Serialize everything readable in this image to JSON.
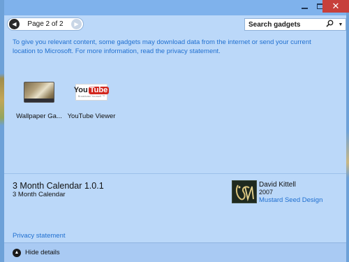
{
  "window": {
    "minimize_icon": "minimize-icon",
    "maximize_icon": "maximize-icon",
    "close_icon": "close-icon",
    "close_glyph": "✕"
  },
  "pager": {
    "label": "Page 2 of 2",
    "prev_icon": "chevron-left-icon",
    "next_icon": "chevron-right-icon"
  },
  "search": {
    "placeholder": "Search gadgets",
    "icon": "search-icon",
    "dropdown_icon": "chevron-down-icon"
  },
  "notice": "To give you relevant content, some gadgets may download data from the internet or send your current location to Microsoft. For more information, read the privacy statement.",
  "gadgets": [
    {
      "label": "Wallpaper Ga...",
      "thumbnail": "wallpaper-thumbnail"
    },
    {
      "label": "YouTube Viewer",
      "thumbnail": "youtube-thumbnail",
      "logo_you": "You",
      "logo_tube": "Tube",
      "logo_tag": "Broadcast Yourself ™"
    }
  ],
  "details": {
    "title": "3 Month Calendar 1.0.1",
    "subtitle": "3 Month Calendar",
    "author": "David Kittell",
    "year": "2007",
    "publisher": "Mustard Seed Design",
    "author_logo": "mustard-seed-logo"
  },
  "privacy_link": "Privacy statement",
  "footer": {
    "toggle_label": "Hide details",
    "toggle_icon": "chevron-up-icon"
  },
  "colors": {
    "background": "#bbd8f9",
    "link": "#1f6fd0",
    "close_button": "#c7403b",
    "footer": "#a9caf3"
  }
}
